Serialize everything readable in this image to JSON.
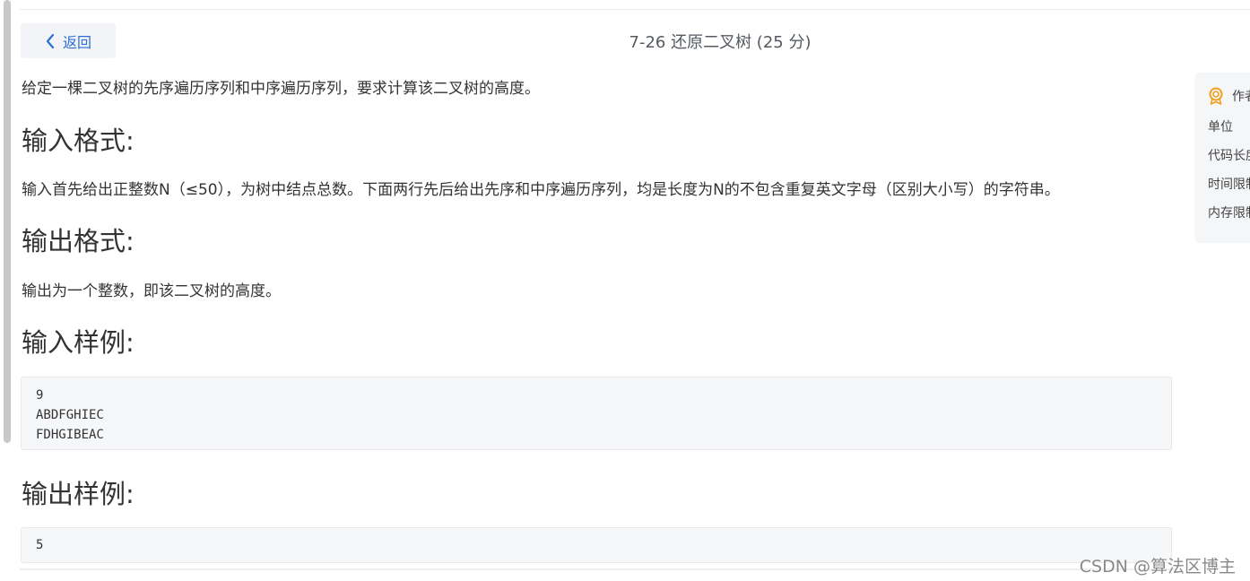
{
  "header": {
    "back_label": "返回",
    "title": "7-26 还原二叉树 (25 分)"
  },
  "problem": {
    "description": "给定一棵二叉树的先序遍历序列和中序遍历序列，要求计算该二叉树的高度。",
    "input_heading": "输入格式:",
    "input_text": "输入首先给出正整数N（≤50），为树中结点总数。下面两行先后给出先序和中序遍历序列，均是长度为N的不包含重复英文字母（区别大小写）的字符串。",
    "output_heading": "输出格式:",
    "output_text": "输出为一个整数，即该二叉树的高度。",
    "sample_input_heading": "输入样例:",
    "sample_input_lines": [
      "9",
      "ABDFGHIEC",
      "FDHGIBEAC"
    ],
    "sample_output_heading": "输出样例:",
    "sample_output_lines": [
      "5"
    ]
  },
  "side_panel": {
    "rows": [
      "作者",
      "单位",
      "代码长度",
      "时间限制",
      "内存限制"
    ]
  },
  "watermark": "CSDN @算法区博主"
}
